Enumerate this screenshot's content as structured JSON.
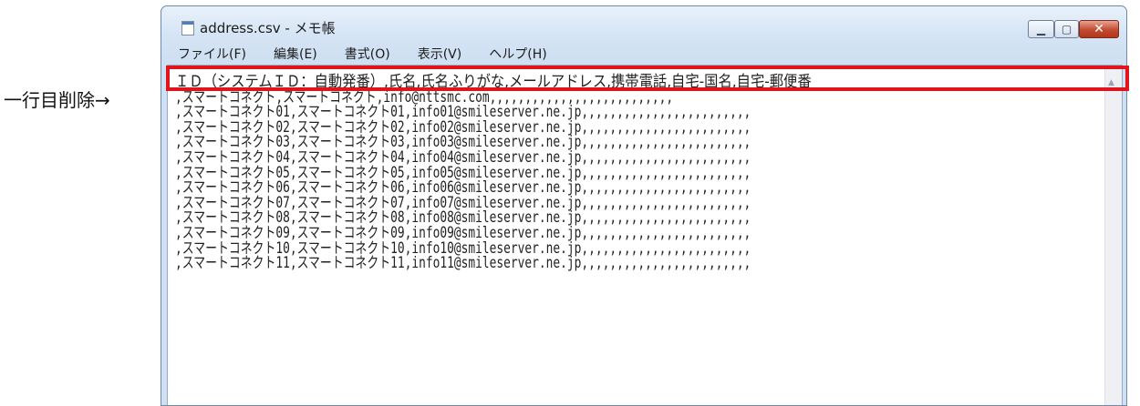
{
  "annotation": "一行目削除→",
  "window": {
    "title": "address.csv - メモ帳",
    "controls": {
      "minimize": "▁",
      "maximize": "▢",
      "close": "✕"
    }
  },
  "menu": [
    "ファイル(F)",
    "編集(E)",
    "書式(O)",
    "表示(V)",
    "ヘルプ(H)"
  ],
  "lines": [
    "ＩＤ（システムＩＤ：自動発番）,氏名,氏名ふりがな,メールアドレス,携帯電話,自宅-国名,自宅-郵便番",
    ",スマートコネクト,スマートコネクト,info@nttsmc.com,,,,,,,,,,,,,,,,,,,,,,,,,,",
    ",スマートコネクト01,スマートコネクト01,info01@smileserver.ne.jp,,,,,,,,,,,,,,,,,,,,,,,,",
    ",スマートコネクト02,スマートコネクト02,info02@smileserver.ne.jp,,,,,,,,,,,,,,,,,,,,,,,,",
    ",スマートコネクト03,スマートコネクト03,info03@smileserver.ne.jp,,,,,,,,,,,,,,,,,,,,,,,,",
    ",スマートコネクト04,スマートコネクト04,info04@smileserver.ne.jp,,,,,,,,,,,,,,,,,,,,,,,,",
    ",スマートコネクト05,スマートコネクト05,info05@smileserver.ne.jp,,,,,,,,,,,,,,,,,,,,,,,,",
    ",スマートコネクト06,スマートコネクト06,info06@smileserver.ne.jp,,,,,,,,,,,,,,,,,,,,,,,,",
    ",スマートコネクト07,スマートコネクト07,info07@smileserver.ne.jp,,,,,,,,,,,,,,,,,,,,,,,,",
    ",スマートコネクト08,スマートコネクト08,info08@smileserver.ne.jp,,,,,,,,,,,,,,,,,,,,,,,,",
    ",スマートコネクト09,スマートコネクト09,info09@smileserver.ne.jp,,,,,,,,,,,,,,,,,,,,,,,,",
    ",スマートコネクト10,スマートコネクト10,info10@smileserver.ne.jp,,,,,,,,,,,,,,,,,,,,,,,,",
    ",スマートコネクト11,スマートコネクト11,info11@smileserver.ne.jp,,,,,,,,,,,,,,,,,,,,,,,,"
  ],
  "colors": {
    "highlight": "#e0141c",
    "window_frame": "#cfe0f2",
    "close_button": "#c24a2e"
  },
  "icons": {
    "doc": "notepad-icon",
    "scroll": "scroll-up-arrow-icon"
  }
}
